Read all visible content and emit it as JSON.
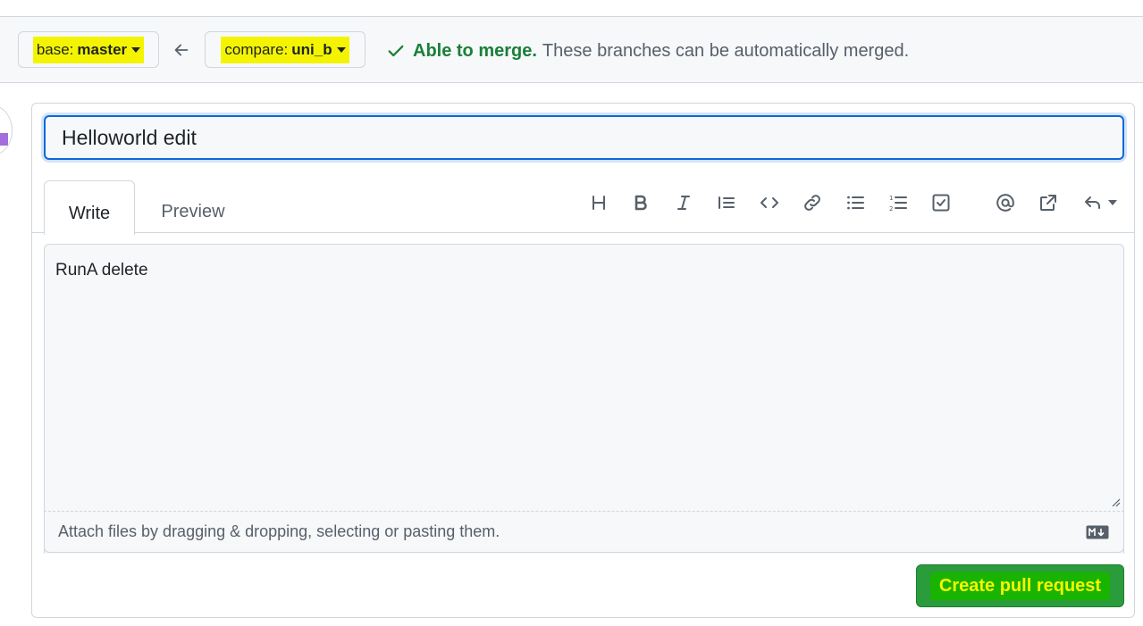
{
  "branches": {
    "base_label": "base:",
    "base_value": "master",
    "compare_label": "compare:",
    "compare_value": "uni_b"
  },
  "merge_status": {
    "title": "Able to merge.",
    "description": "These branches can be automatically merged."
  },
  "form": {
    "title_value": "Helloworld edit",
    "tabs": [
      "Write",
      "Preview"
    ],
    "toolbar": [
      "heading-icon",
      "bold-icon",
      "italic-icon",
      "quote-icon",
      "code-icon",
      "link-icon",
      "bulleted-list-icon",
      "numbered-list-icon",
      "task-list-icon",
      "mention-icon",
      "reference-icon",
      "reply-icon"
    ],
    "comment_text": "RunA delete",
    "attach_hint": "Attach files by dragging & dropping, selecting or pasting them.",
    "submit_label": "Create pull request"
  },
  "colors": {
    "highlight_yellow": "#f4f400",
    "merge_green": "#1a7f37",
    "button_green": "#2a9c3c",
    "focus_blue": "#0969da"
  }
}
